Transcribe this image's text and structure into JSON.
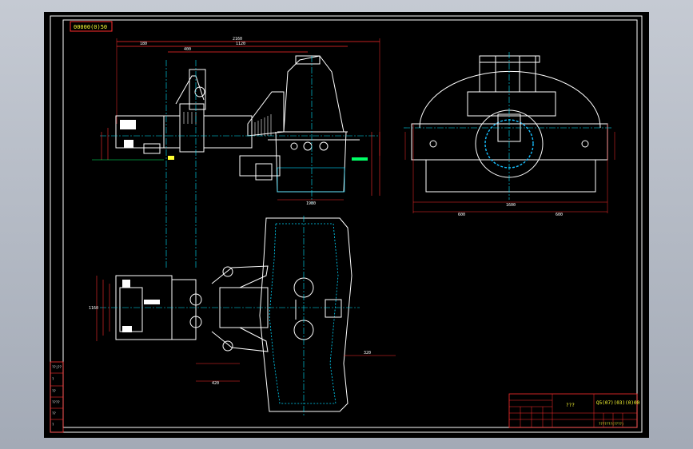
{
  "viewport": {
    "background": "#a9b0bd",
    "sheet_color": "#000000"
  },
  "drawing": {
    "code_tag": "00000(0)50",
    "title_label": "???",
    "drawing_number": "Q5(07)(03)(0)00",
    "drawing_subtitle": "???????(????)",
    "colors": {
      "frame": "#ff3b30",
      "outline": "#ffffff",
      "dimension": "#ff2d2d",
      "centerline": "#00e5ff",
      "detail": "#00d8ff",
      "annotation": "#ffff33",
      "accent": "#00ff66",
      "fill": "#17bfff"
    }
  },
  "title_block": {
    "rows": [
      "",
      "",
      "",
      "",
      "",
      ""
    ],
    "side_table": [
      "??|??",
      "?",
      "??",
      "????",
      "??",
      "?"
    ]
  },
  "dimensions": {
    "front_overall": "2160",
    "front_upper": "1120",
    "front_right": "1980",
    "front_small_a": "180",
    "front_small_b": "400",
    "side_overall": "1600",
    "side_left": "600",
    "side_right": "600",
    "plan_left": "1160",
    "plan_bottom": "420",
    "plan_right": "320"
  }
}
